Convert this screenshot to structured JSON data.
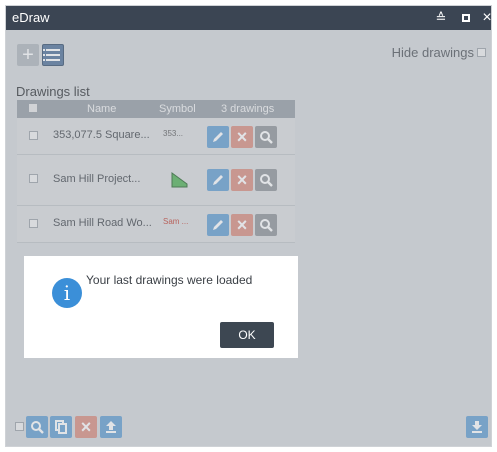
{
  "window": {
    "title": "eDraw"
  },
  "toolbar": {
    "add_icon": "plus-icon",
    "list_icon": "list-icon",
    "hide_drawings_label": "Hide drawings"
  },
  "drawings_list": {
    "title": "Drawings list",
    "columns": {
      "name": "Name",
      "symbol": "Symbol",
      "count": "3 drawings"
    },
    "rows": [
      {
        "name": "353,077.5 Square...",
        "symbol_text": "353...",
        "symbol_type": "text"
      },
      {
        "name": "Sam Hill Project...",
        "symbol_text": "",
        "symbol_type": "polygon"
      },
      {
        "name": "Sam Hill Road Wo...",
        "symbol_text": "Sam ...",
        "symbol_type": "text"
      }
    ]
  },
  "dialog": {
    "message": "Your last drawings were loaded",
    "ok_label": "OK",
    "icon": "info-icon"
  },
  "colors": {
    "titlebar": "#3b4553",
    "accent_blue": "#5e9bd0",
    "delete_red": "#d98a7c",
    "polygon_fill": "#4caf50",
    "row3_symbol_color": "#c0392b"
  }
}
